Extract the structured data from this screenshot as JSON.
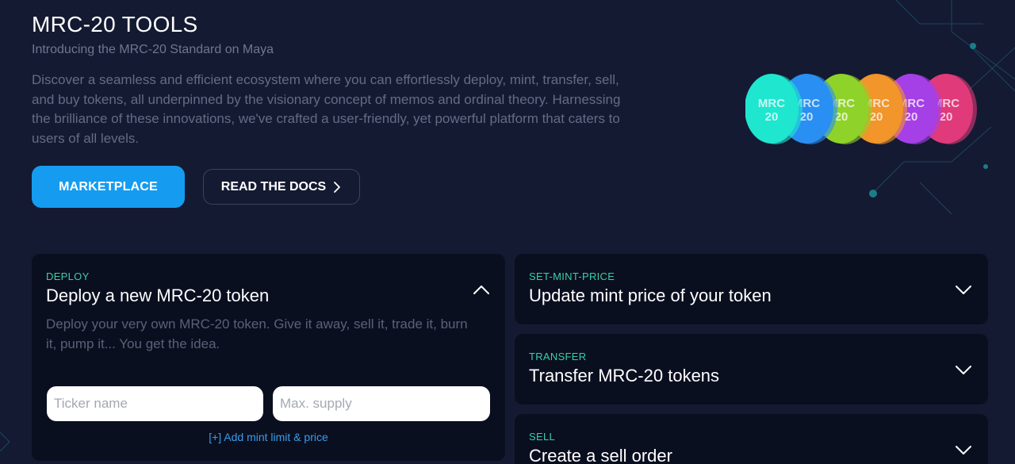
{
  "hero": {
    "title": "MRC-20 TOOLS",
    "subtitle": "Introducing the MRC-20 Standard on Maya",
    "description": "Discover a seamless and efficient ecosystem where you can effortlessly deploy, mint, transfer, sell, and buy tokens, all underpinned by the visionary concept of memos and ordinal theory. Harnessing the brilliance of these innovations, we've crafted a user-friendly, yet powerful platform that caters to users of all levels."
  },
  "buttons": {
    "marketplace": "MARKETPLACE",
    "docs": "READ THE DOCS"
  },
  "coins": {
    "label_top": "MRC",
    "label_bottom": "20",
    "colors": [
      "#e03a7a",
      "#a53fe6",
      "#f2952a",
      "#8fd22a",
      "#2a8ff2",
      "#1fe6cf"
    ]
  },
  "cards": {
    "deploy": {
      "tag": "DEPLOY",
      "title": "Deploy a new MRC-20 token",
      "description": "Deploy your very own MRC-20 token. Give it away, sell it, trade it, burn it, pump it... You get the idea.",
      "ticker_placeholder": "Ticker name",
      "supply_placeholder": "Max. supply",
      "add_mint": "[+] Add mint limit & price"
    },
    "set_mint_price": {
      "tag": "SET-MINT-PRICE",
      "title": "Update mint price of your token"
    },
    "transfer": {
      "tag": "TRANSFER",
      "title": "Transfer MRC-20 tokens"
    },
    "sell": {
      "tag": "SELL",
      "title": "Create a sell order"
    }
  },
  "colors": {
    "background": "#141a31",
    "card": "#0a0f20",
    "accent": "#159cf0",
    "tag": "#39d0a5"
  }
}
